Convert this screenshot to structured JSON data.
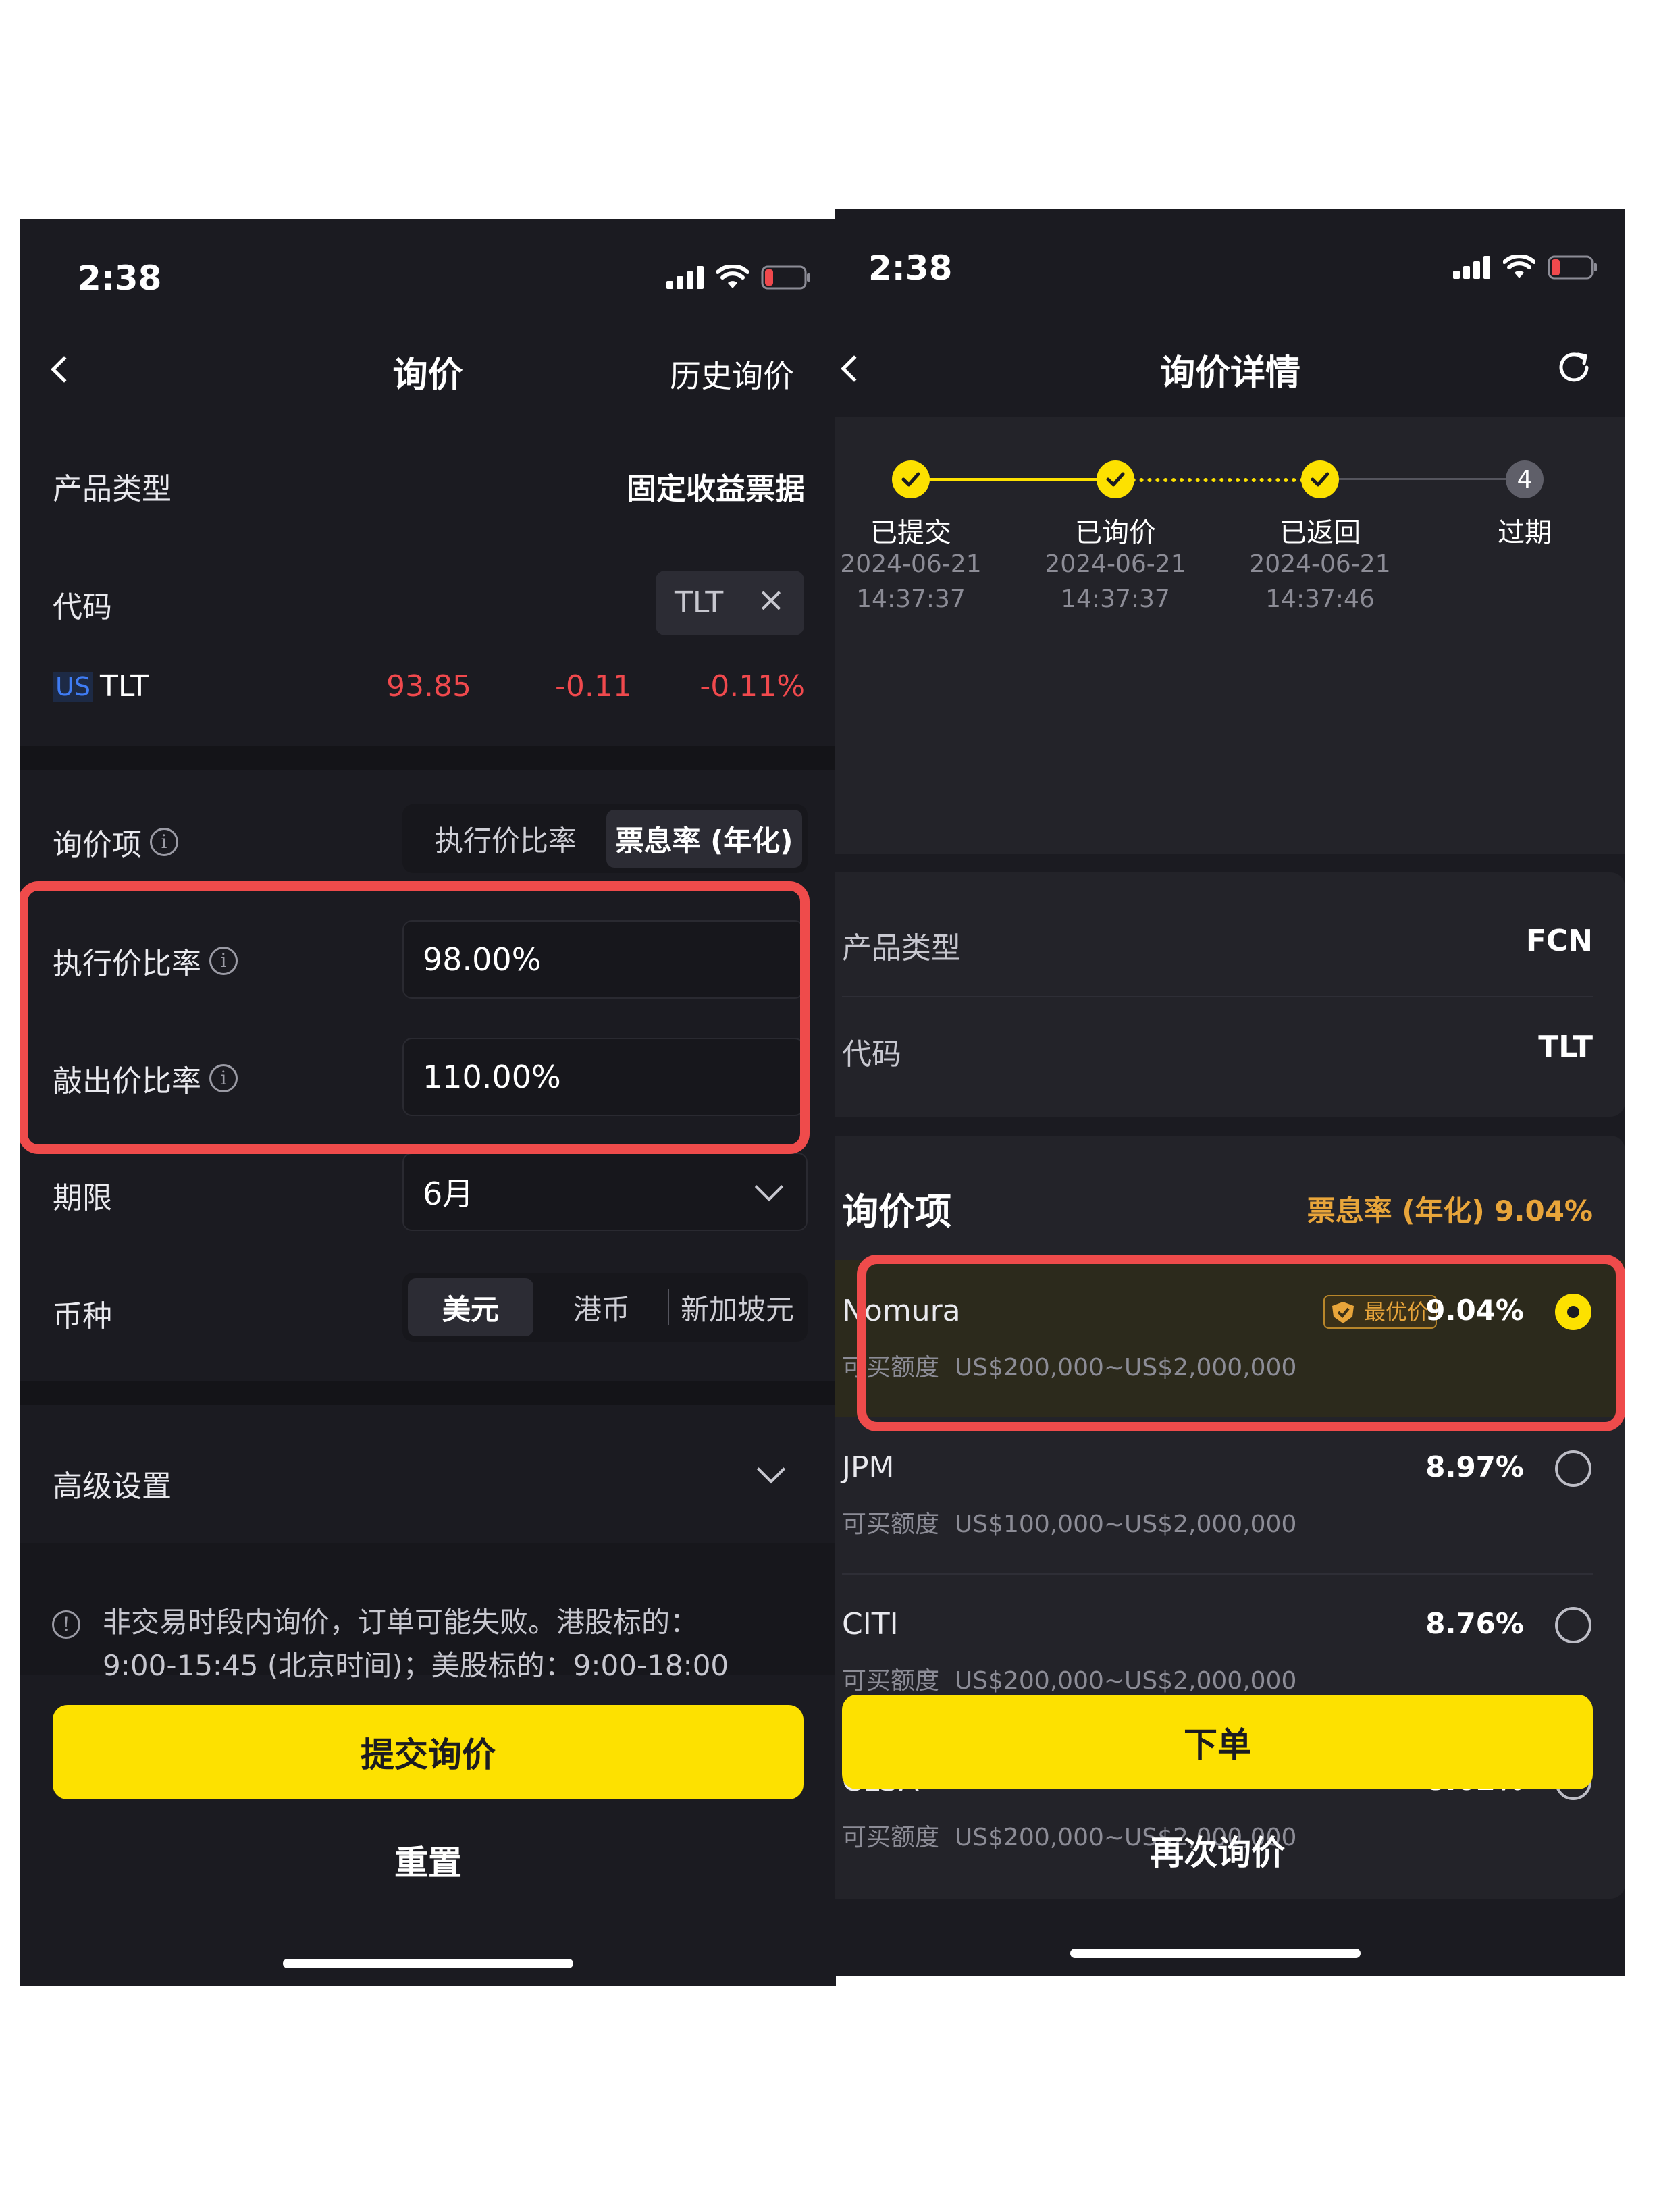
{
  "left": {
    "status": {
      "time": "2:38"
    },
    "nav": {
      "title": "询价",
      "history": "历史询价"
    },
    "product": {
      "label": "产品类型",
      "value": "固定收益票据"
    },
    "code": {
      "label": "代码",
      "chip": "TLT"
    },
    "quote": {
      "market": "US",
      "symbol": "TLT",
      "price": "93.85",
      "change": "-0.11",
      "change_pct": "-0.11%"
    },
    "inquiry": {
      "label": "询价项",
      "options": [
        "执行价比率",
        "票息率 (年化)"
      ],
      "selected": 1
    },
    "strike": {
      "label": "执行价比率",
      "value": "98.00%"
    },
    "knockout": {
      "label": "敲出价比率",
      "value": "110.00%"
    },
    "term": {
      "label": "期限",
      "value": "6月"
    },
    "currency": {
      "label": "币种",
      "options": [
        "美元",
        "港币",
        "新加坡元"
      ],
      "selected": 0
    },
    "advanced": {
      "label": "高级设置"
    },
    "notice": {
      "line1": "非交易时段内询价，订单可能失败。港股标的：",
      "line2": "9:00-15:45 (北京时间)；美股标的：9:00-18:00"
    },
    "submit": "提交询价",
    "reset": "重置"
  },
  "right": {
    "status": {
      "time": "2:38"
    },
    "nav": {
      "title": "询价详情"
    },
    "steps": [
      {
        "label": "已提交",
        "date": "2024-06-21",
        "time": "14:37:37"
      },
      {
        "label": "已询价",
        "date": "2024-06-21",
        "time": "14:37:37"
      },
      {
        "label": "已返回",
        "date": "2024-06-21",
        "time": "14:37:46"
      },
      {
        "label": "过期",
        "number": "4"
      }
    ],
    "product": {
      "label": "产品类型",
      "value": "FCN"
    },
    "code": {
      "label": "代码",
      "value": "TLT"
    },
    "inquiry": {
      "title": "询价项",
      "summary": "票息率 (年化) 9.04%"
    },
    "amount_label": "可买额度",
    "best_badge": "最优价",
    "quotes": [
      {
        "name": "Nomura",
        "rate": "9.04%",
        "range": "US$200,000~US$2,000,000",
        "selected": true
      },
      {
        "name": "JPM",
        "rate": "8.97%",
        "range": "US$100,000~US$2,000,000"
      },
      {
        "name": "CITI",
        "rate": "8.76%",
        "range": "US$200,000~US$2,000,000"
      },
      {
        "name": "CLSA",
        "rate": "8.62%",
        "range": "US$200,000~US$2,000,000"
      }
    ],
    "order": "下单",
    "requote": "再次询价"
  },
  "colors": {
    "accent": "#fde100",
    "highlight": "#ef4b4b",
    "down": "#f0494d",
    "gold": "#e8a53a"
  }
}
